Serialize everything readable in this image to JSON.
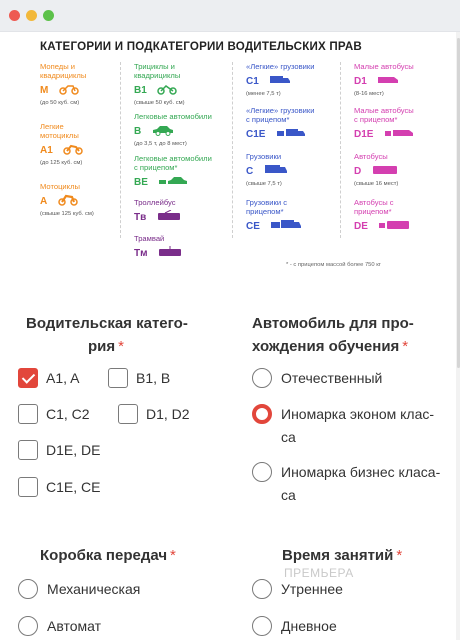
{
  "infographic": {
    "title": "КАТЕГОРИИ И ПОДКАТЕГОРИИ ВОДИТЕЛЬСКИХ ПРАВ",
    "col1": [
      {
        "name": "Мопеды и квадрициклы",
        "code": "M",
        "desc": "(до 50 куб. см)"
      },
      {
        "name": "Легкие мотоциклы",
        "code": "A1",
        "desc": "(до 125 куб. см)"
      },
      {
        "name": "Мотоциклы",
        "code": "A",
        "desc": "(свыше 125 куб. см)"
      }
    ],
    "col2": [
      {
        "name": "Трициклы и квадрициклы",
        "code": "B1",
        "desc": "(свыше 50 куб. см)"
      },
      {
        "name": "Легковые автомобили",
        "code": "B",
        "desc": "(до 3,5 т, до 8 мест)"
      },
      {
        "name": "Легковые автомобили с прицепом*",
        "code": "BE",
        "desc": ""
      },
      {
        "name": "Троллейбус",
        "code": "Tв",
        "desc": ""
      },
      {
        "name": "Трамвай",
        "code": "Tм",
        "desc": ""
      }
    ],
    "col3": [
      {
        "name": "«Легкие» грузовики",
        "code": "C1",
        "desc": "(менее 7,5 т)"
      },
      {
        "name": "«Легкие» грузовики с прицепом*",
        "code": "C1E",
        "desc": ""
      },
      {
        "name": "Грузовики",
        "code": "C",
        "desc": "(свыше 7,5 т)"
      },
      {
        "name": "Грузовики с прицепом*",
        "code": "CE",
        "desc": ""
      }
    ],
    "col4": [
      {
        "name": "Малые автобусы",
        "code": "D1",
        "desc": "(8-16 мест)"
      },
      {
        "name": "Малые автобусы с прицепом*",
        "code": "D1E",
        "desc": ""
      },
      {
        "name": "Автобусы",
        "code": "D",
        "desc": "(свыше 16 мест)"
      },
      {
        "name": "Автобусы с прицепом*",
        "code": "DE",
        "desc": ""
      }
    ],
    "footnote": "* - с прицепом массой более 750 кг",
    "colors": {
      "orange": "#f08a1d",
      "green": "#34a853",
      "blue": "#3a57c8",
      "pink": "#d43fb0",
      "purple": "#7a2d8a"
    }
  },
  "form": {
    "category": {
      "label_line1": "Водительская катего-",
      "label_line2": "рия",
      "required_mark": "*",
      "options": [
        "A1, A",
        "B1, B",
        "C1, C2",
        "D1, D2",
        "D1E, DE",
        "C1E, CE"
      ],
      "checked": [
        "A1, A"
      ]
    },
    "car": {
      "label_line1": "Автомобиль для про-",
      "label_line2": "хождения обучения",
      "required_mark": "*",
      "options": [
        {
          "line1": "Отечественный",
          "line2": ""
        },
        {
          "line1": "Иномарка эконом клас-",
          "line2": "са"
        },
        {
          "line1": "Иномарка бизнес класа-",
          "line2": "са"
        }
      ],
      "selected": "Иномарка эконом класса"
    },
    "gearbox": {
      "label": "Коробка передач",
      "required_mark": "*",
      "options": [
        "Механическая",
        "Автомат"
      ]
    },
    "time": {
      "label": "Время занятий",
      "required_mark": "*",
      "options": [
        "Утреннее",
        "Дневное"
      ]
    },
    "watermark": "ПРЕМЬЕРА"
  },
  "window_controls": {
    "close_color": "#ee5a52",
    "minimize_color": "#f2b83a",
    "maximize_color": "#5cc14a"
  },
  "accent_color": "#e2463b"
}
